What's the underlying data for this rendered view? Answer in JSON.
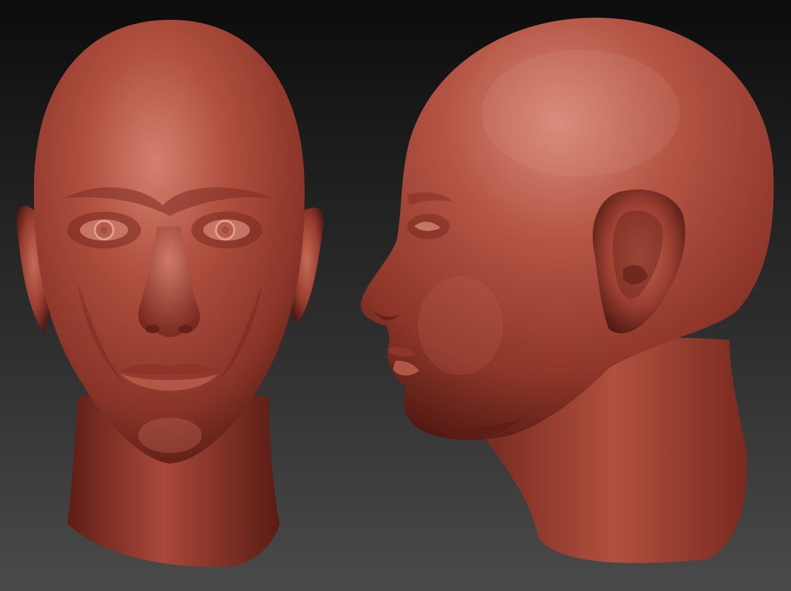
{
  "render": {
    "background_top": "#0c0c0c",
    "background_bottom": "#4a4a4a",
    "material_color": "#a8473a",
    "material_highlight": "#d88070",
    "material_shadow": "#4a1612"
  },
  "views": [
    {
      "name": "front",
      "icon": "head-front"
    },
    {
      "name": "side",
      "icon": "head-profile"
    }
  ]
}
